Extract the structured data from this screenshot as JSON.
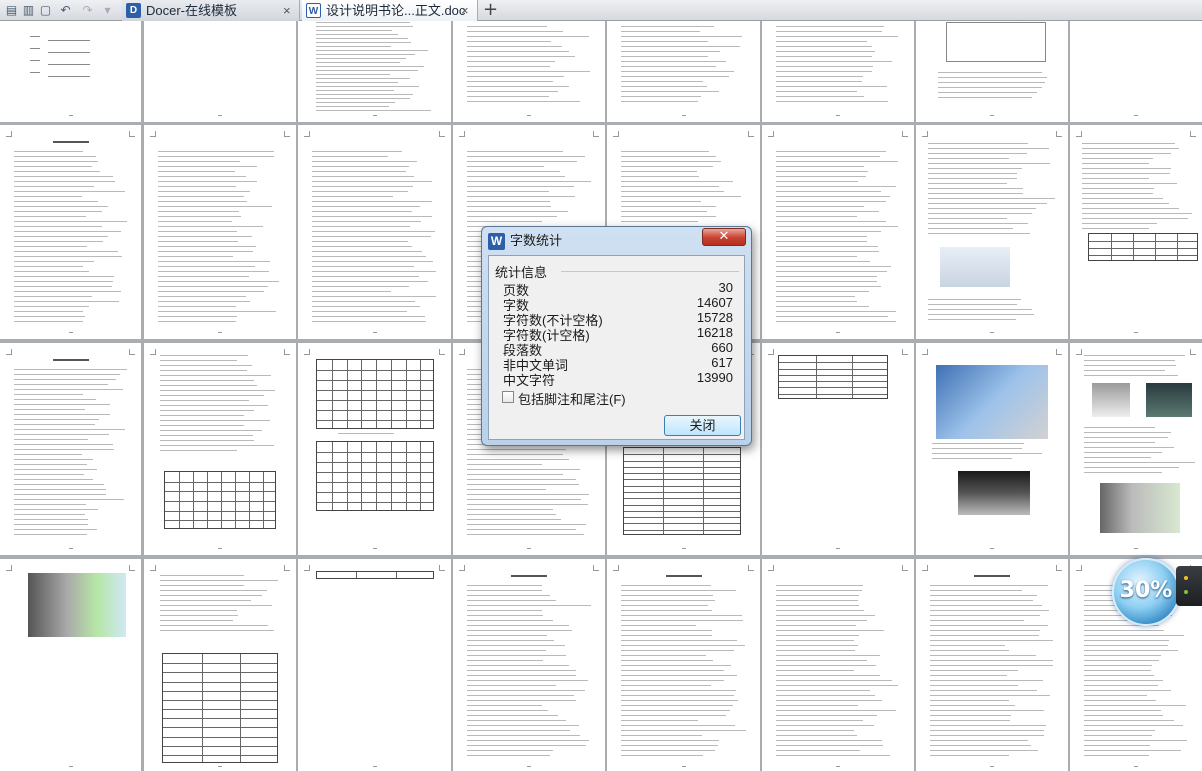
{
  "toolbar": {
    "icons": [
      "print-icon",
      "print-preview-icon",
      "undo-icon",
      "redo-icon"
    ]
  },
  "tabs": [
    {
      "label": "Docer-在线模板"
    },
    {
      "label": "设计说明书论...正文.doc"
    }
  ],
  "dialog": {
    "title": "字数统计",
    "group_label": "统计信息",
    "stats": [
      {
        "label": "页数",
        "value": "30"
      },
      {
        "label": "字数",
        "value": "14607"
      },
      {
        "label": "字符数(不计空格)",
        "value": "15728"
      },
      {
        "label": "字符数(计空格)",
        "value": "16218"
      },
      {
        "label": "段落数",
        "value": "660"
      },
      {
        "label": "非中文单词",
        "value": "617"
      },
      {
        "label": "中文字符",
        "value": "13990"
      }
    ],
    "checkbox_label": "包括脚注和尾注(F)",
    "checkbox_checked": false,
    "close_button": "关闭"
  },
  "widget": {
    "label": "30%"
  }
}
